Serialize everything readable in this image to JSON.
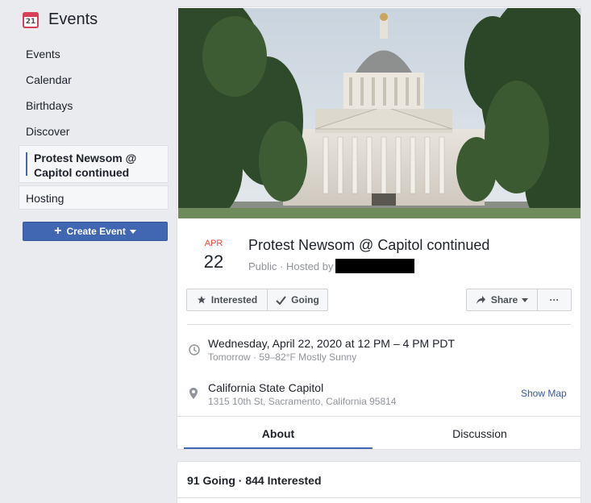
{
  "sidebar": {
    "title": "Events",
    "calendar_icon_day": "21",
    "items": [
      {
        "label": "Events"
      },
      {
        "label": "Calendar"
      },
      {
        "label": "Birthdays"
      },
      {
        "label": "Discover"
      }
    ],
    "active_event": "Protest Newsom @ Capitol continued",
    "hosting": "Hosting",
    "create_button": "Create Event"
  },
  "event": {
    "month": "APR",
    "day": "22",
    "title": "Protest Newsom @ Capitol continued",
    "subtitle": "Public · Hosted by",
    "buttons": {
      "interested": "Interested",
      "going": "Going",
      "share": "Share",
      "more": "···"
    },
    "time": {
      "main": "Wednesday, April 22, 2020 at 12 PM – 4 PM PDT",
      "sub": "Tomorrow · 59–82°F Mostly Sunny"
    },
    "location": {
      "main": "California State Capitol",
      "sub": "1315 10th St, Sacramento, California 95814",
      "show_map": "Show Map"
    },
    "tabs": [
      {
        "label": "About"
      },
      {
        "label": "Discussion"
      }
    ],
    "stats": "91 Going · 844 Interested"
  },
  "colors": {
    "accent": "#4267b2",
    "date_red": "#e74c3c",
    "background": "#e9ebee"
  }
}
